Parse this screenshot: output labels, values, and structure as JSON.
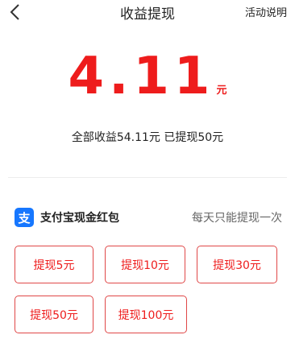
{
  "header": {
    "title": "收益提现",
    "rules_label": "活动说明"
  },
  "balance": {
    "amount": "4.11",
    "unit": "元",
    "summary": "全部收益54.11元 已提现50元"
  },
  "payout": {
    "logo_glyph": "支",
    "label": "支付宝现金红包",
    "hint": "每天只能提现一次"
  },
  "options": [
    {
      "label": "提现5元"
    },
    {
      "label": "提现10元"
    },
    {
      "label": "提现30元"
    },
    {
      "label": "提现50元"
    },
    {
      "label": "提现100元"
    }
  ],
  "colors": {
    "accent": "#ee1c1c",
    "alipay_blue": "#1677ff"
  }
}
